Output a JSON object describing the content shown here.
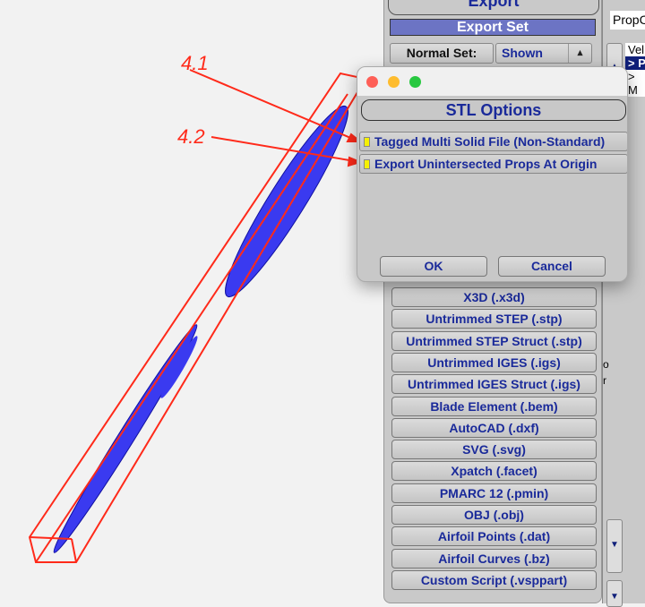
{
  "annotations": {
    "a1": "4.1",
    "a2": "4.2",
    "color": "#ff2a1a"
  },
  "export_panel": {
    "title": "Export",
    "set_header": "Export Set",
    "normal_set_label": "Normal Set:",
    "normal_set_value": "Shown",
    "formats": [
      "X3D (.x3d)",
      "Untrimmed STEP (.stp)",
      "Untrimmed STEP Struct (.stp)",
      "Untrimmed IGES (.igs)",
      "Untrimmed IGES Struct (.igs)",
      "Blade Element (.bem)",
      "AutoCAD (.dxf)",
      "SVG (.svg)",
      "Xpatch (.facet)",
      "PMARC 12 (.pmin)",
      "OBJ (.obj)",
      "Airfoil Points (.dat)",
      "Airfoil Curves (.bz)",
      "Custom Script (.vsppart)"
    ]
  },
  "right_panel": {
    "field_value": "PropC",
    "list": [
      "Vel",
      "> P",
      "> M"
    ],
    "fragments": [
      "o",
      "r"
    ]
  },
  "dialog": {
    "title": "STL Options",
    "options": [
      {
        "label": "Tagged Multi Solid File (Non-Standard)",
        "checked": false
      },
      {
        "label": "Export Unintersected Props At Origin",
        "checked": false
      }
    ],
    "ok": "OK",
    "cancel": "Cancel"
  },
  "colors": {
    "accent": "#1a2a9a",
    "header": "#6c74c4",
    "mesh": "#2a2ae6",
    "checkbox": "#f5f000"
  }
}
